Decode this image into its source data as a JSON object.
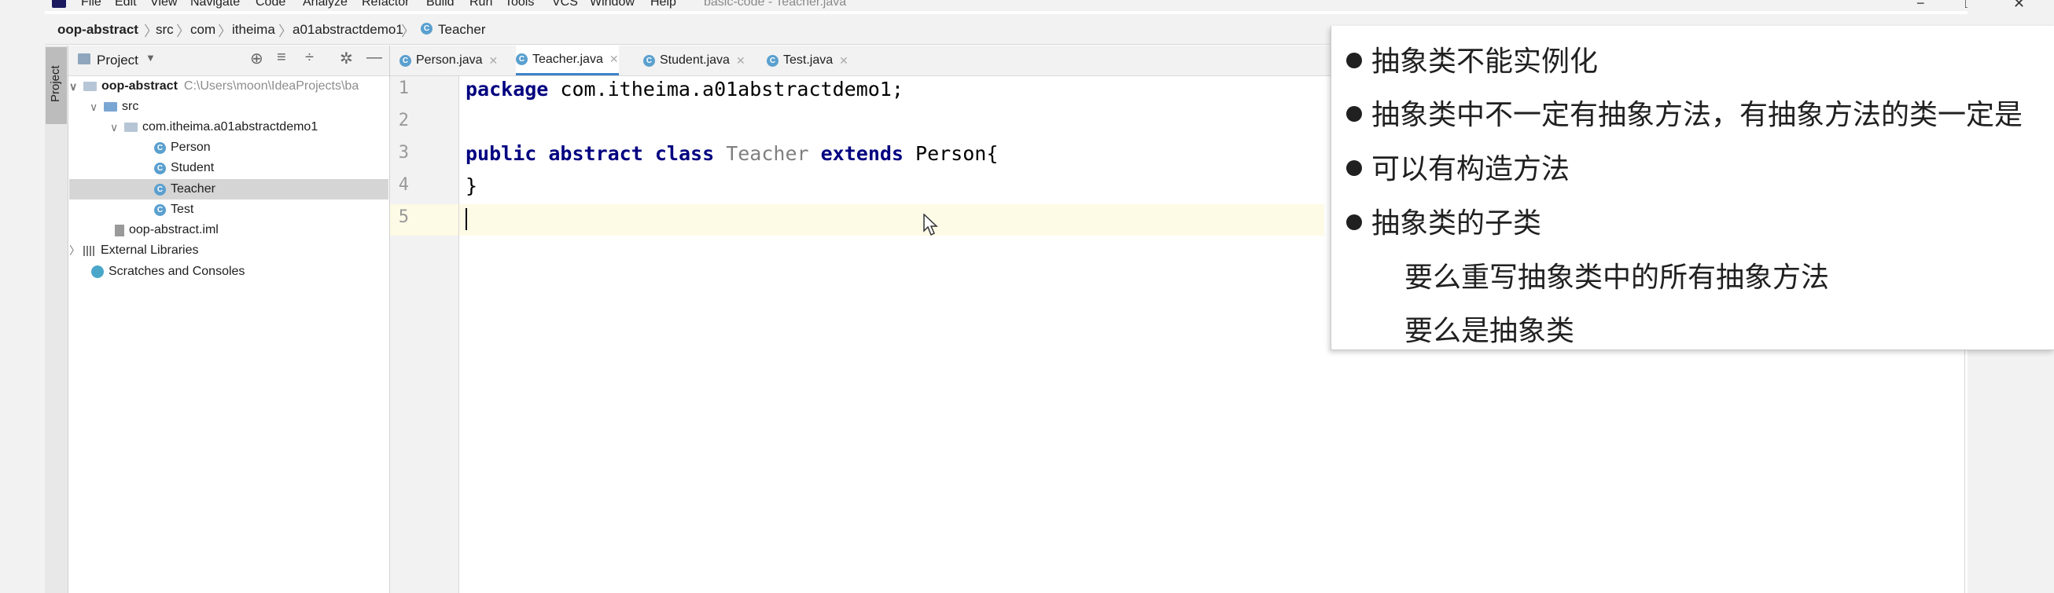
{
  "menu": [
    "File",
    "Edit",
    "View",
    "Navigate",
    "Code",
    "Analyze",
    "Refactor",
    "Build",
    "Run",
    "Tools",
    "VCS",
    "Window",
    "Help"
  ],
  "window_title": "basic-code - Teacher.java",
  "window_controls": {
    "minimize": "−",
    "maximize": "□",
    "close": "✕"
  },
  "breadcrumb": [
    "oop-abstract",
    "src",
    "com",
    "itheima",
    "a01abstractdemo1",
    "Teacher"
  ],
  "project_panel": {
    "title": "Project",
    "stripe_label": "Project",
    "tree": [
      {
        "label": "oop-abstract",
        "path": "C:\\Users\\moon\\IdeaProjects\\ba"
      },
      {
        "label": "src"
      },
      {
        "label": "com.itheima.a01abstractdemo1"
      },
      {
        "label": "Person",
        "badge": "C"
      },
      {
        "label": "Student",
        "badge": "C"
      },
      {
        "label": "Teacher",
        "badge": "C"
      },
      {
        "label": "Test",
        "badge": "C"
      },
      {
        "label": "oop-abstract.iml"
      },
      {
        "label": "External Libraries"
      },
      {
        "label": "Scratches and Consoles"
      }
    ]
  },
  "tabs": [
    {
      "label": "Person.java",
      "badge": "C"
    },
    {
      "label": "Teacher.java",
      "badge": "C",
      "active": true
    },
    {
      "label": "Student.java",
      "badge": "C"
    },
    {
      "label": "Test.java",
      "badge": "C"
    }
  ],
  "editor": {
    "line_numbers": [
      "1",
      "2",
      "3",
      "4",
      "5"
    ],
    "line1": {
      "kw": "package",
      "rest": " com.itheima.a01abstractdemo1;"
    },
    "line3": {
      "kw1": "public",
      "kw2": "abstract",
      "kw3": "class",
      "name": "Teacher",
      "kw4": "extends",
      "rest": " Person{"
    },
    "line4": "}"
  },
  "overlay": {
    "bullets": [
      "抽象类不能实例化",
      "抽象类中不一定有抽象方法，有抽象方法的类一定是",
      "可以有构造方法",
      "抽象类的子类"
    ],
    "sub_items": [
      "要么重写抽象类中的所有抽象方法",
      "要么是抽象类"
    ]
  },
  "icons": {
    "project": "folder-icon",
    "class": "class-icon",
    "close": "close-icon"
  }
}
